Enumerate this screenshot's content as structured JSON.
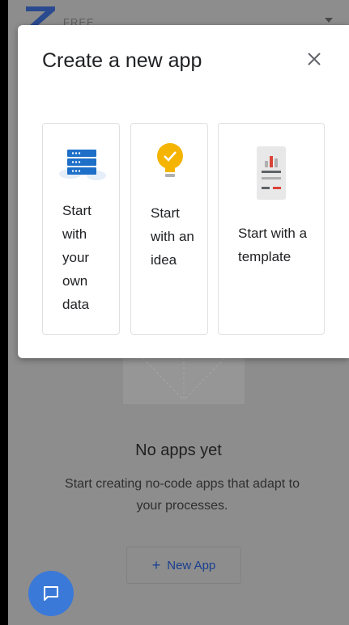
{
  "header": {
    "plan_label": "FREE"
  },
  "modal": {
    "title": "Create a new app",
    "options": [
      {
        "label": "Start with your own data",
        "icon": "server-icon"
      },
      {
        "label": "Start with an idea",
        "icon": "lightbulb-icon"
      },
      {
        "label": "Start with a template",
        "icon": "phone-template-icon"
      }
    ]
  },
  "empty_state": {
    "title": "No apps yet",
    "subtitle": "Start creating no-code apps that adapt to your processes."
  },
  "new_app_button": {
    "plus": "+",
    "label": "New App"
  },
  "colors": {
    "accent": "#3b79d8",
    "button_text": "#1a3f8f",
    "bulb": "#f4b400",
    "server": "#1e6fc8",
    "template_red": "#db4437"
  }
}
